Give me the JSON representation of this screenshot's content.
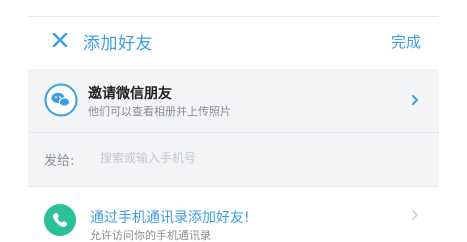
{
  "header": {
    "title": "添加好友",
    "done_label": "完成",
    "close_icon": "close-icon"
  },
  "wechat_row": {
    "title": "邀请微信朋友",
    "subtitle": "他们可以查看相册并上传照片",
    "icon": "wechat-icon"
  },
  "send_to": {
    "label": "发给:",
    "placeholder": "搜索或输入手机号"
  },
  "contacts_row": {
    "title": "通过手机通讯录添加好友!",
    "subtitle": "允许访问你的手机通讯录",
    "icon": "phone-icon"
  },
  "colors": {
    "accent": "#3d9ee1",
    "wechat": "#3d9ee1",
    "phone": "#2bbf9a",
    "section_bg": "#f3f4f6"
  }
}
